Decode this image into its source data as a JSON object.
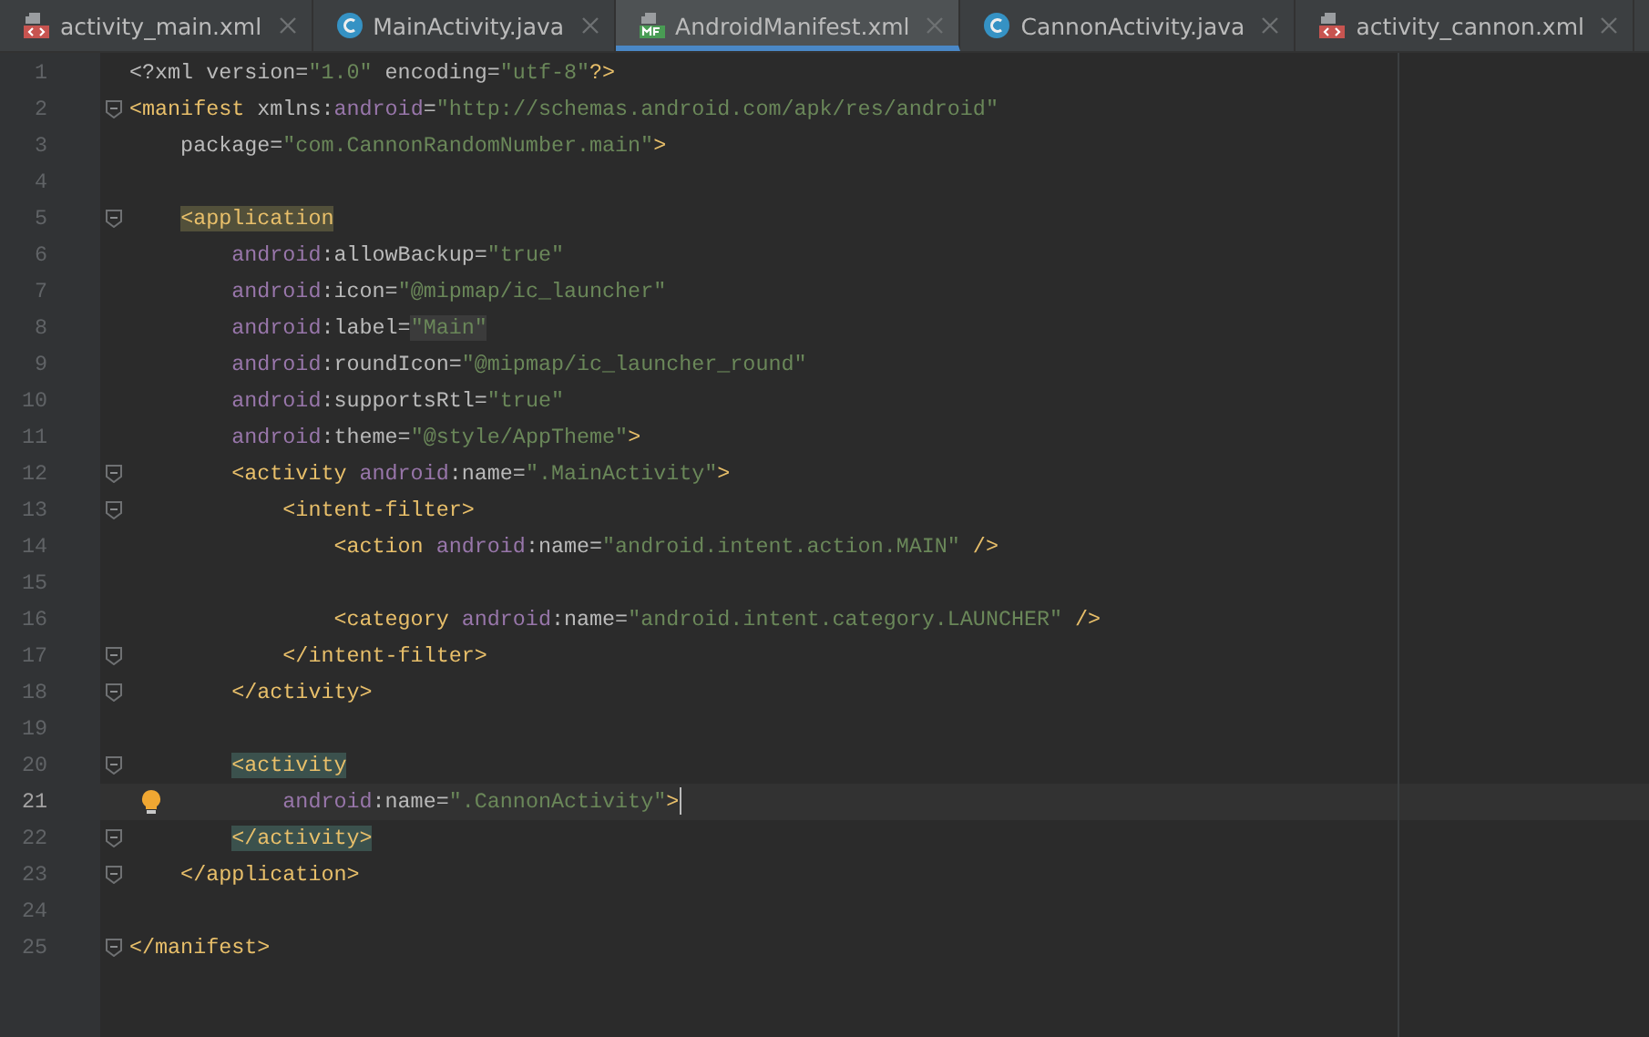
{
  "tabs": [
    {
      "label": "activity_main.xml",
      "kind": "layout",
      "selected": false
    },
    {
      "label": "MainActivity.java",
      "kind": "class",
      "selected": false
    },
    {
      "label": "AndroidManifest.xml",
      "kind": "manifest",
      "selected": true
    },
    {
      "label": "CannonActivity.java",
      "kind": "class",
      "selected": false
    },
    {
      "label": "activity_cannon.xml",
      "kind": "layout",
      "selected": false
    }
  ],
  "editor": {
    "lines": [
      {
        "n": "1",
        "fold": false,
        "current": false,
        "intention": false,
        "tokens": [
          {
            "t": "<?xml version=",
            "kind": "attr"
          },
          {
            "t": "\"1.0\"",
            "kind": "str"
          },
          {
            "t": " encoding=",
            "kind": "attr"
          },
          {
            "t": "\"utf-8\"",
            "kind": "str"
          },
          {
            "t": "?>",
            "kind": "tag"
          }
        ]
      },
      {
        "n": "2",
        "fold": true,
        "current": false,
        "intention": false,
        "tokens": [
          {
            "t": "<manifest ",
            "kind": "tag"
          },
          {
            "t": "xmlns:",
            "kind": "attr"
          },
          {
            "t": "android",
            "kind": "ns"
          },
          {
            "t": "=",
            "kind": "attr"
          },
          {
            "t": "\"http://schemas.android.com/apk/res/android\"",
            "kind": "str"
          }
        ]
      },
      {
        "n": "3",
        "fold": false,
        "current": false,
        "intention": false,
        "tokens": [
          {
            "t": "    package=",
            "kind": "attr"
          },
          {
            "t": "\"com.CannonRandomNumber.main\"",
            "kind": "str"
          },
          {
            "t": ">",
            "kind": "tag"
          }
        ]
      },
      {
        "n": "4",
        "fold": false,
        "current": false,
        "intention": false
      },
      {
        "n": "5",
        "fold": true,
        "current": false,
        "intention": false,
        "tokens": [
          {
            "t": "    <application",
            "kind": "tag",
            "color": "#52503a"
          }
        ]
      },
      {
        "n": "6",
        "fold": false,
        "current": false,
        "intention": false,
        "tokens": [
          {
            "t": "        android",
            "kind": "ns"
          },
          {
            "t": ":allowBackup=",
            "kind": "attr"
          },
          {
            "t": "\"true\"",
            "kind": "str"
          }
        ]
      },
      {
        "n": "7",
        "fold": false,
        "current": false,
        "intention": false,
        "tokens": [
          {
            "t": "        android",
            "kind": "ns"
          },
          {
            "t": ":icon=",
            "kind": "attr"
          },
          {
            "t": "\"@mipmap/ic_launcher\"",
            "kind": "str"
          }
        ]
      },
      {
        "n": "8",
        "fold": false,
        "current": false,
        "intention": false,
        "tokens": [
          {
            "t": "        android",
            "kind": "ns"
          },
          {
            "t": ":label=",
            "kind": "attr"
          },
          {
            "t": "\"Main\"",
            "kind": "str",
            "color": "#3b3b3b"
          }
        ]
      },
      {
        "n": "9",
        "fold": false,
        "current": false,
        "intention": false,
        "tokens": [
          {
            "t": "        android",
            "kind": "ns"
          },
          {
            "t": ":roundIcon=",
            "kind": "attr"
          },
          {
            "t": "\"@mipmap/ic_launcher_round\"",
            "kind": "str"
          }
        ]
      },
      {
        "n": "10",
        "fold": false,
        "current": false,
        "intention": false,
        "tokens": [
          {
            "t": "        android",
            "kind": "ns"
          },
          {
            "t": ":supportsRtl=",
            "kind": "attr"
          },
          {
            "t": "\"true\"",
            "kind": "str"
          }
        ]
      },
      {
        "n": "11",
        "fold": false,
        "current": false,
        "intention": false,
        "tokens": [
          {
            "t": "        android",
            "kind": "ns"
          },
          {
            "t": ":theme=",
            "kind": "attr"
          },
          {
            "t": "\"@style/AppTheme\"",
            "kind": "str"
          },
          {
            "t": ">",
            "kind": "tag"
          }
        ]
      },
      {
        "n": "12",
        "fold": true,
        "current": false,
        "intention": false,
        "tokens": [
          {
            "t": "        <activity ",
            "kind": "tag"
          },
          {
            "t": "android",
            "kind": "ns"
          },
          {
            "t": ":name=",
            "kind": "attr"
          },
          {
            "t": "\".MainActivity\"",
            "kind": "str"
          },
          {
            "t": ">",
            "kind": "tag"
          }
        ]
      },
      {
        "n": "13",
        "fold": true,
        "current": false,
        "intention": false,
        "tokens": [
          {
            "t": "            <intent-filter>",
            "kind": "tag"
          }
        ]
      },
      {
        "n": "14",
        "fold": false,
        "current": false,
        "intention": false,
        "tokens": [
          {
            "t": "                <action ",
            "kind": "tag"
          },
          {
            "t": "android",
            "kind": "ns"
          },
          {
            "t": ":name=",
            "kind": "attr"
          },
          {
            "t": "\"android.intent.action.MAIN\"",
            "kind": "str"
          },
          {
            "t": " />",
            "kind": "tag"
          }
        ]
      },
      {
        "n": "15",
        "fold": false,
        "current": false,
        "intention": false
      },
      {
        "n": "16",
        "fold": false,
        "current": false,
        "intention": false,
        "tokens": [
          {
            "t": "                <category ",
            "kind": "tag"
          },
          {
            "t": "android",
            "kind": "ns"
          },
          {
            "t": ":name=",
            "kind": "attr"
          },
          {
            "t": "\"android.intent.category.LAUNCHER\"",
            "kind": "str"
          },
          {
            "t": " />",
            "kind": "tag"
          }
        ]
      },
      {
        "n": "17",
        "fold": true,
        "current": false,
        "intention": false,
        "tokens": [
          {
            "t": "            </intent-filter>",
            "kind": "tag"
          }
        ]
      },
      {
        "n": "18",
        "fold": true,
        "current": false,
        "intention": false,
        "tokens": [
          {
            "t": "        </activity>",
            "kind": "tag"
          }
        ]
      },
      {
        "n": "19",
        "fold": false,
        "current": false,
        "intention": false
      },
      {
        "n": "20",
        "fold": true,
        "current": false,
        "intention": false,
        "tokens": [
          {
            "t": "        <activity",
            "kind": "tag",
            "color": "#3b514d"
          }
        ]
      },
      {
        "n": "21",
        "fold": false,
        "current": true,
        "intention": true,
        "tokens": [
          {
            "t": "            android",
            "kind": "ns"
          },
          {
            "t": ":name=",
            "kind": "attr"
          },
          {
            "t": "\".CannonActivity\"",
            "kind": "str"
          },
          {
            "t": ">",
            "kind": "tag"
          }
        ]
      },
      {
        "n": "22",
        "fold": true,
        "current": false,
        "intention": false,
        "tokens": [
          {
            "t": "        </activity>",
            "kind": "tag",
            "color": "#3b514d"
          }
        ]
      },
      {
        "n": "23",
        "fold": true,
        "current": false,
        "intention": false,
        "tokens": [
          {
            "t": "    </application>",
            "kind": "tag"
          }
        ]
      },
      {
        "n": "24",
        "fold": false,
        "current": false,
        "intention": false
      },
      {
        "n": "25",
        "fold": true,
        "current": false,
        "intention": false,
        "tokens": [
          {
            "t": "</manifest>",
            "kind": "tag"
          }
        ]
      }
    ]
  }
}
